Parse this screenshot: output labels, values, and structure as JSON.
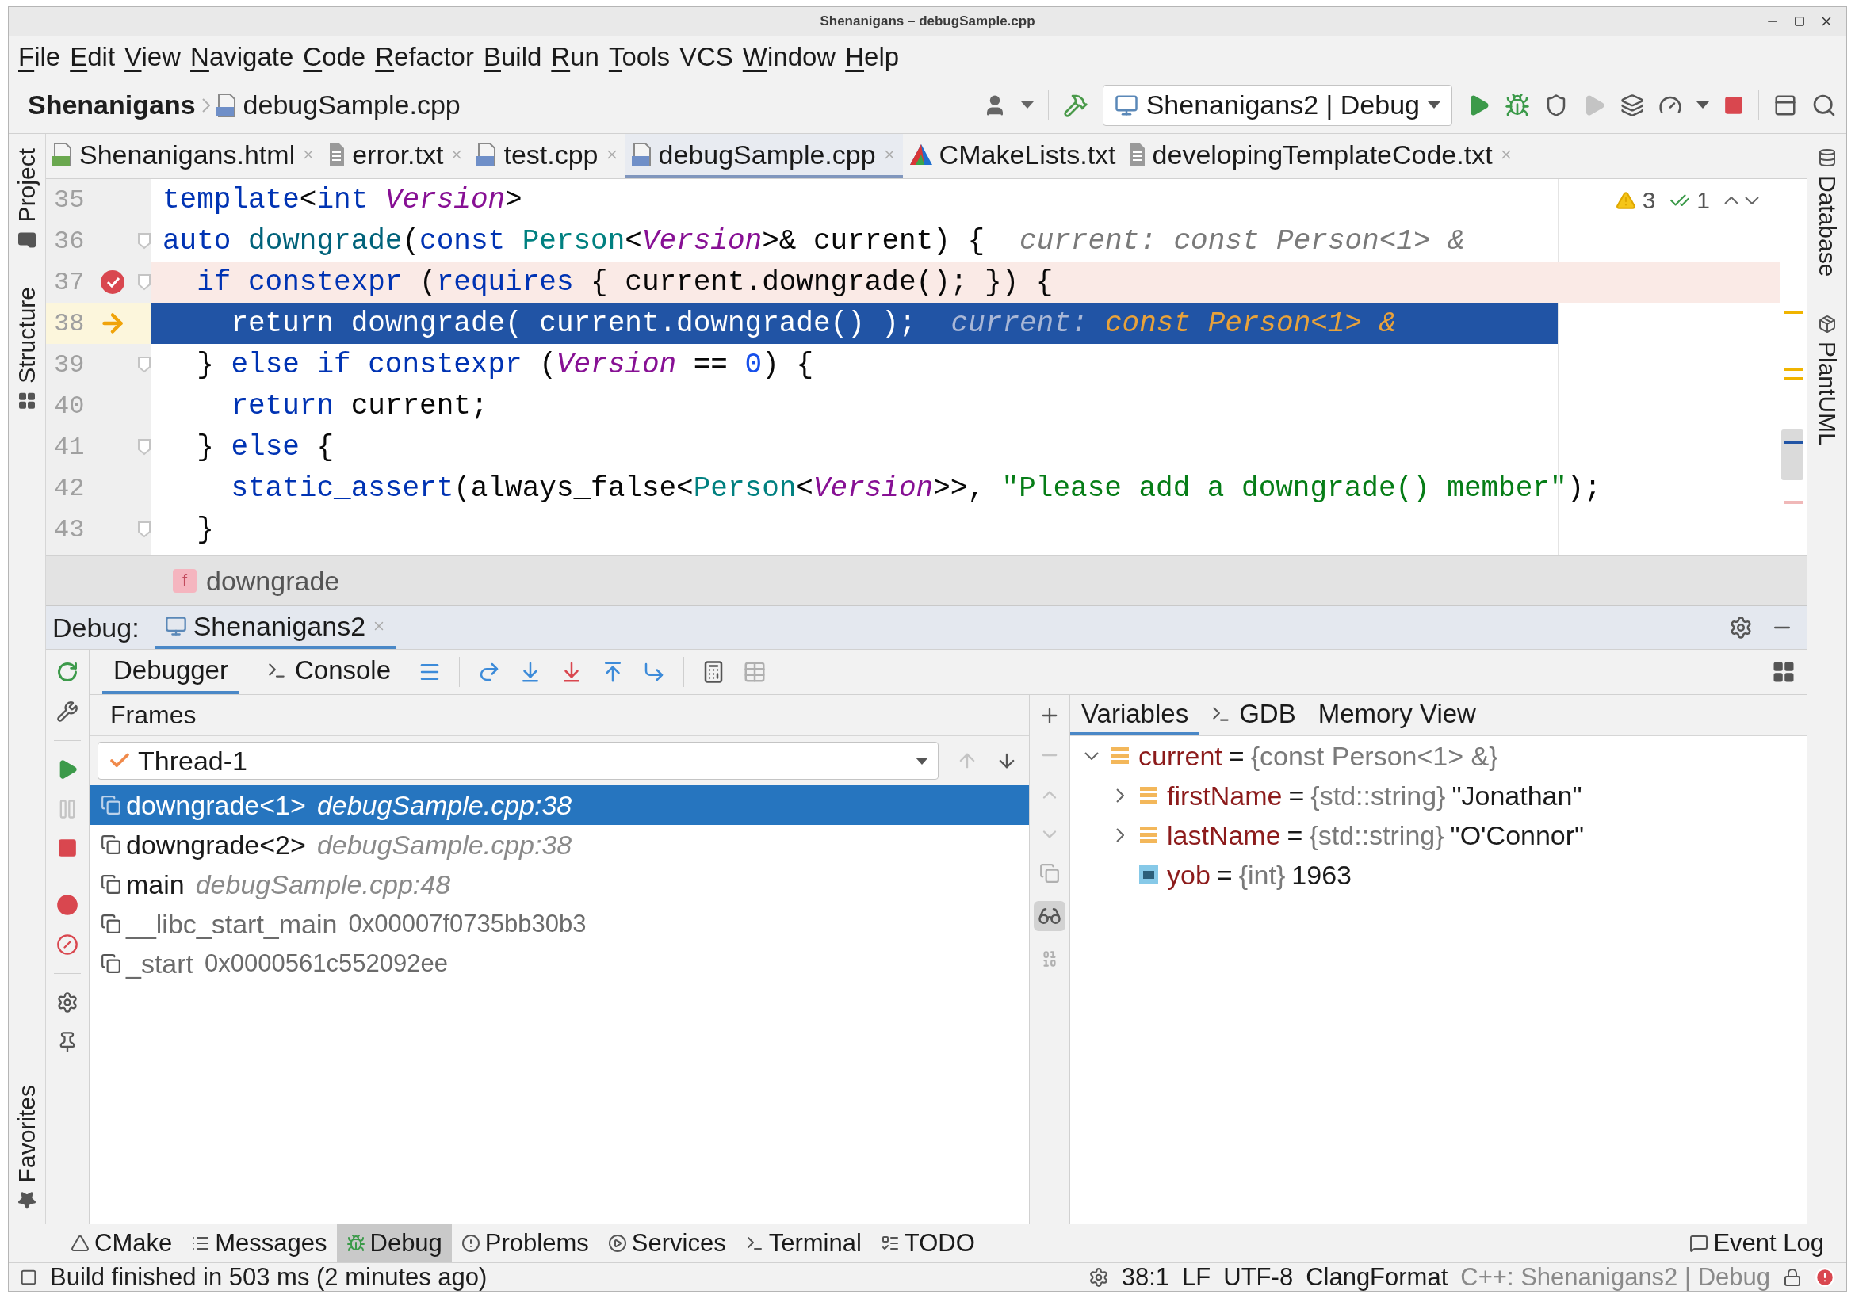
{
  "window": {
    "title": "Shenanigans – debugSample.cpp"
  },
  "menu": [
    {
      "label": "File",
      "underlined": true
    },
    {
      "label": "Edit",
      "underlined": true
    },
    {
      "label": "View",
      "underlined": true
    },
    {
      "label": "Navigate",
      "underlined": true
    },
    {
      "label": "Code",
      "underlined": true
    },
    {
      "label": "Refactor",
      "underlined": true
    },
    {
      "label": "Build",
      "underlined": true
    },
    {
      "label": "Run",
      "underlined": true
    },
    {
      "label": "Tools",
      "underlined": true
    },
    {
      "label": "VCS",
      "underlined": false
    },
    {
      "label": "Window",
      "underlined": true
    },
    {
      "label": "Help",
      "underlined": true
    }
  ],
  "navigation": {
    "project": "Shenanigans",
    "file": "debugSample.cpp",
    "run_configuration": "Shenanigans2 | Debug"
  },
  "left_stripe": {
    "top": [
      "Project",
      "Structure"
    ],
    "bottom": [
      "Favorites"
    ]
  },
  "right_stripe": [
    "Database",
    "PlantUML"
  ],
  "editor_tabs": [
    {
      "label": "Shenanigans.html",
      "kind": "html",
      "selected": false,
      "closable": true
    },
    {
      "label": "error.txt",
      "kind": "text",
      "selected": false,
      "closable": true
    },
    {
      "label": "test.cpp",
      "kind": "cpp",
      "selected": false,
      "closable": true
    },
    {
      "label": "debugSample.cpp",
      "kind": "cpp",
      "selected": true,
      "closable": true
    },
    {
      "label": "CMakeLists.txt",
      "kind": "cmake",
      "selected": false,
      "closable": false
    },
    {
      "label": "developingTemplateCode.txt",
      "kind": "text",
      "selected": false,
      "closable": true
    }
  ],
  "editor": {
    "inspections": {
      "warnings": "3",
      "weak_warnings": "1"
    },
    "lines": [
      {
        "number": "35",
        "kind": "normal",
        "fold": false,
        "tokens": [
          {
            "text": "template",
            "kind": "keyword"
          },
          {
            "text": "<",
            "kind": "plain"
          },
          {
            "text": "int ",
            "kind": "keyword"
          },
          {
            "text": "Version",
            "kind": "template_param"
          },
          {
            "text": ">",
            "kind": "plain"
          }
        ]
      },
      {
        "number": "36",
        "kind": "normal",
        "fold": true,
        "tokens": [
          {
            "text": "auto ",
            "kind": "keyword"
          },
          {
            "text": "downgrade",
            "kind": "function"
          },
          {
            "text": "(",
            "kind": "plain"
          },
          {
            "text": "const ",
            "kind": "keyword"
          },
          {
            "text": "Person",
            "kind": "type"
          },
          {
            "text": "<",
            "kind": "plain"
          },
          {
            "text": "Version",
            "kind": "template_param"
          },
          {
            "text": ">& current) {",
            "kind": "plain"
          }
        ],
        "hint": {
          "label": "current:",
          "value": "const Person<1> &"
        }
      },
      {
        "number": "37",
        "kind": "breakpoint",
        "fold": true,
        "tokens": [
          {
            "text": "  if constexpr",
            "kind": "keyword"
          },
          {
            "text": " (",
            "kind": "plain"
          },
          {
            "text": "requires",
            "kind": "keyword"
          },
          {
            "text": " { current.downgrade(); }) {",
            "kind": "plain"
          }
        ]
      },
      {
        "number": "38",
        "kind": "execution",
        "fold": false,
        "tokens": [
          {
            "text": "    return",
            "kind": "keyword"
          },
          {
            "text": " downgrade( current.downgrade() );",
            "kind": "plain"
          }
        ],
        "hint": {
          "label": "current:",
          "value": "const Person<1> &"
        }
      },
      {
        "number": "39",
        "kind": "normal",
        "fold": true,
        "tokens": [
          {
            "text": "  } ",
            "kind": "plain"
          },
          {
            "text": "else if constexpr",
            "kind": "keyword"
          },
          {
            "text": " (",
            "kind": "plain"
          },
          {
            "text": "Version",
            "kind": "template_param"
          },
          {
            "text": " == ",
            "kind": "plain"
          },
          {
            "text": "0",
            "kind": "number"
          },
          {
            "text": ") {",
            "kind": "plain"
          }
        ]
      },
      {
        "number": "40",
        "kind": "normal",
        "fold": false,
        "tokens": [
          {
            "text": "    return",
            "kind": "keyword"
          },
          {
            "text": " current;",
            "kind": "plain"
          }
        ]
      },
      {
        "number": "41",
        "kind": "normal",
        "fold": true,
        "tokens": [
          {
            "text": "  } ",
            "kind": "plain"
          },
          {
            "text": "else",
            "kind": "keyword"
          },
          {
            "text": " {",
            "kind": "plain"
          }
        ]
      },
      {
        "number": "42",
        "kind": "normal",
        "fold": false,
        "tokens": [
          {
            "text": "    static_assert",
            "kind": "keyword"
          },
          {
            "text": "(always_false<",
            "kind": "plain"
          },
          {
            "text": "Person",
            "kind": "type"
          },
          {
            "text": "<",
            "kind": "plain"
          },
          {
            "text": "Version",
            "kind": "template_param"
          },
          {
            "text": ">>, ",
            "kind": "plain"
          },
          {
            "text": "\"Please add a downgrade() member\"",
            "kind": "string"
          },
          {
            "text": ");",
            "kind": "plain"
          }
        ]
      },
      {
        "number": "43",
        "kind": "normal",
        "fold": true,
        "tokens": [
          {
            "text": "  }",
            "kind": "plain"
          }
        ]
      }
    ]
  },
  "breadcrumb": {
    "badge": "f",
    "label": "downgrade"
  },
  "debug": {
    "title": "Debug:",
    "session": {
      "label": "Shenanigans2",
      "selected": true
    },
    "tabs": [
      {
        "label": "Debugger",
        "selected": true
      },
      {
        "label": "Console",
        "selected": false
      }
    ],
    "frames": {
      "title": "Frames",
      "thread": "Thread-1",
      "items": [
        {
          "name": "downgrade<1>",
          "location": "debugSample.cpp:38",
          "kind": "source",
          "selected": true
        },
        {
          "name": "downgrade<2>",
          "location": "debugSample.cpp:38",
          "kind": "source",
          "selected": false
        },
        {
          "name": "main",
          "location": "debugSample.cpp:48",
          "kind": "source",
          "selected": false
        },
        {
          "name": "__libc_start_main",
          "location": "0x00007f0735bb30b3",
          "kind": "library",
          "selected": false
        },
        {
          "name": "_start",
          "location": "0x0000561c552092ee",
          "kind": "library",
          "selected": false
        }
      ]
    },
    "inline_values": {
      "on": true
    },
    "variables": {
      "tabs": [
        {
          "label": "Variables",
          "selected": true
        },
        {
          "label": "GDB",
          "selected": false
        },
        {
          "label": "Memory View",
          "selected": false
        }
      ],
      "tree": [
        {
          "name": "current",
          "op": "=",
          "type": "{const Person<1> &}",
          "kind": "object",
          "expanded": true,
          "children": [
            {
              "name": "firstName",
              "op": "=",
              "type": "{std::string}",
              "value": "\"Jonathan\"",
              "kind": "object",
              "expanded": false
            },
            {
              "name": "lastName",
              "op": "=",
              "type": "{std::string}",
              "value": "\"O'Connor\"",
              "kind": "object",
              "expanded": false
            },
            {
              "name": "yob",
              "op": "=",
              "type": "{int}",
              "value": "1963",
              "kind": "primitive"
            }
          ]
        }
      ]
    }
  },
  "tool_windows": [
    {
      "label": "CMake",
      "selected": false
    },
    {
      "label": "Messages",
      "selected": false
    },
    {
      "label": "Debug",
      "selected": true
    },
    {
      "label": "Problems",
      "selected": false
    },
    {
      "label": "Services",
      "selected": false
    },
    {
      "label": "Terminal",
      "selected": false
    },
    {
      "label": "TODO",
      "selected": false
    }
  ],
  "event_log": "Event Log",
  "status_bar": {
    "message": "Build finished in 503 ms (2 minutes ago)",
    "items": [
      {
        "label": "38:1",
        "dimmed": false
      },
      {
        "label": "LF",
        "dimmed": false
      },
      {
        "label": "UTF-8",
        "dimmed": false
      },
      {
        "label": "ClangFormat",
        "dimmed": false
      },
      {
        "label": "C++: Shenanigans2 | Debug",
        "dimmed": true
      }
    ]
  }
}
